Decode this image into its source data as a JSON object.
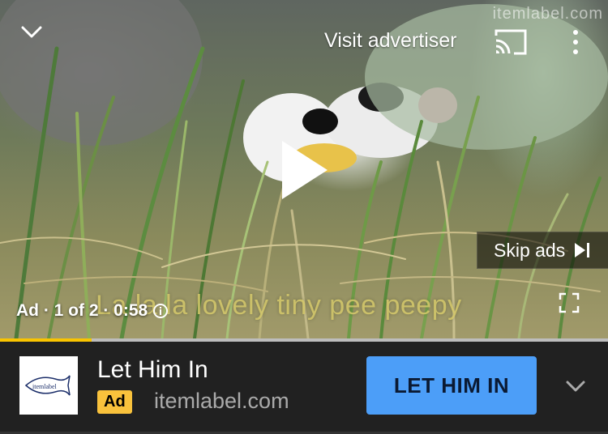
{
  "watermark": "itemlabel.com",
  "player": {
    "visit_advertiser": "Visit advertiser",
    "skip_ads": "Skip ads",
    "caption": "La la la lovely tiny pee peepy",
    "ad_info": "Ad · 1 of 2 · 0:58",
    "progress_fraction": 0.15
  },
  "ad_card": {
    "title": "Let Him In",
    "badge": "Ad",
    "domain": "itemlabel.com",
    "cta": "LET HIM IN",
    "logo_text": "itemlabel"
  },
  "colors": {
    "progress": "#f9c400",
    "cta_bg": "#4c9ef8",
    "badge_bg": "#f9c23c"
  },
  "icons": [
    "chevron-down-icon",
    "cast-icon",
    "more-vert-icon",
    "play-icon",
    "skip-next-icon",
    "info-icon",
    "fullscreen-icon",
    "expand-chevron-icon"
  ]
}
